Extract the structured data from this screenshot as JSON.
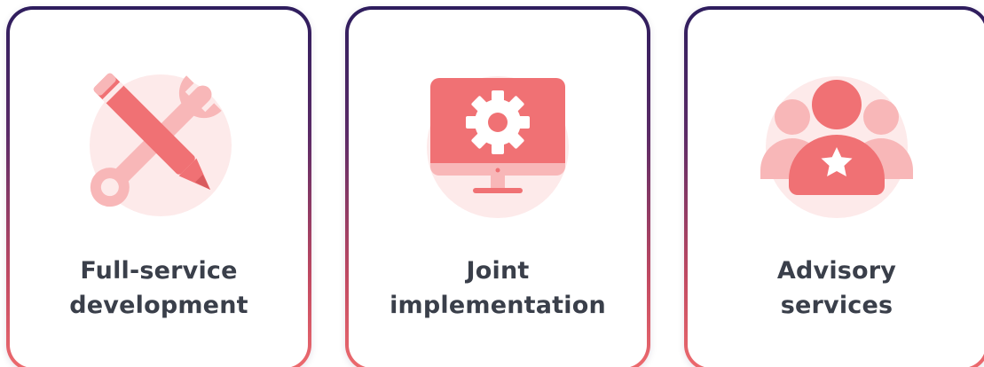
{
  "colors": {
    "accent": "#f07174",
    "accent_light": "#f8b7b8",
    "halo": "#fdeaea",
    "text": "#3a3f4a",
    "border_top": "#2e1d5e",
    "border_bottom": "#ee6b6e"
  },
  "cards": [
    {
      "icon": "wrench-pencil-icon",
      "label_line1": "Full-service",
      "label_line2": "development"
    },
    {
      "icon": "monitor-gear-icon",
      "label_line1": "Joint",
      "label_line2": "implementation"
    },
    {
      "icon": "team-star-icon",
      "label_line1": "Advisory",
      "label_line2": "services"
    }
  ]
}
